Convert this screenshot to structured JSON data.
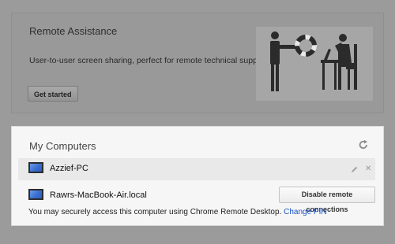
{
  "remote_assistance": {
    "title": "Remote Assistance",
    "description": "User-to-user screen sharing, perfect for remote technical support.",
    "button_label": "Get started"
  },
  "my_computers": {
    "title": "My Computers",
    "computers": [
      {
        "name": "Azzief-PC"
      },
      {
        "name": "Rawrs-MacBook-Air.local",
        "button_label": "Disable remote connections"
      }
    ],
    "note": "You may securely access this computer using Chrome Remote Desktop.",
    "change_pin_label": "Change PIN",
    "close_glyph": "✕"
  },
  "colors": {
    "link": "#1a55c5",
    "monitor_screen": "#3a6fd1",
    "overlay": "#9b9b9b"
  },
  "icons": [
    "refresh-icon",
    "pencil-icon",
    "close-icon",
    "monitor-icon",
    "help-illustration"
  ]
}
